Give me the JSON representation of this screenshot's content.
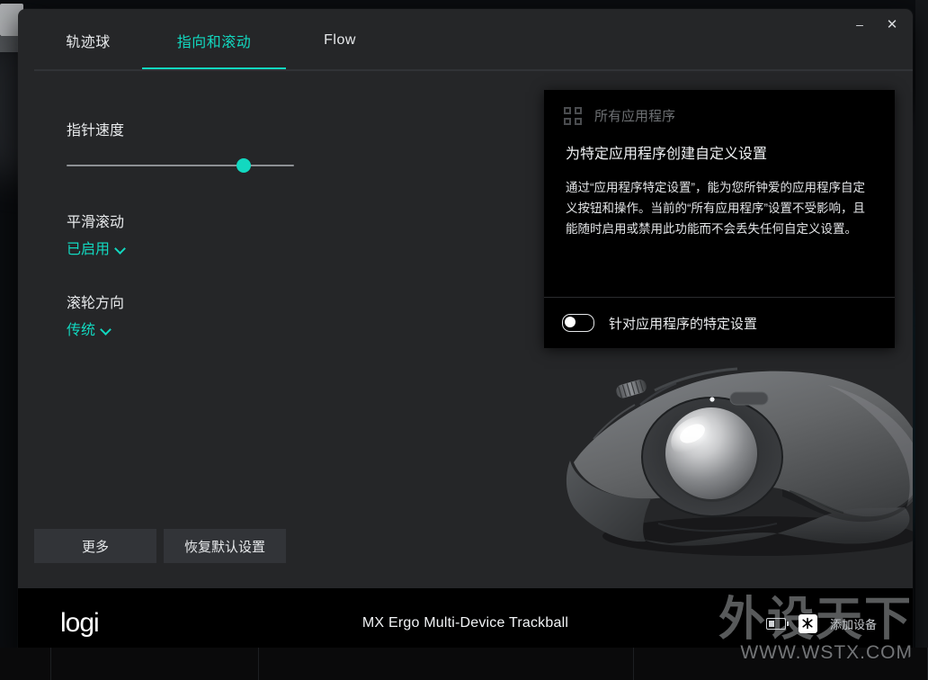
{
  "window": {
    "controls": {
      "minimize": "–",
      "close": "✕"
    }
  },
  "tabs": [
    {
      "label": "轨迹球",
      "active": false
    },
    {
      "label": "指向和滚动",
      "active": true
    },
    {
      "label": "Flow",
      "active": false
    }
  ],
  "settings": {
    "pointer_speed": {
      "label": "指针速度",
      "value_percent": 78
    },
    "smooth_scroll": {
      "label": "平滑滚动",
      "value": "已启用"
    },
    "scroll_direction": {
      "label": "滚轮方向",
      "value": "传统"
    }
  },
  "actions": {
    "more": "更多",
    "restore_defaults": "恢复默认设置"
  },
  "popup": {
    "header_label": "所有应用程序",
    "title": "为特定应用程序创建自定义设置",
    "body": "通过“应用程序特定设置”，能为您所钟爱的应用程序自定义按钮和操作。当前的“所有应用程序”设置不受影响，且能随时启用或禁用此功能而不会丢失任何自定义设置。",
    "toggle_label": "针对应用程序的特定设置",
    "toggle_state": "off"
  },
  "footer": {
    "brand": "logi",
    "device_name": "MX Ergo Multi-Device Trackball",
    "add_device": "添加设备"
  },
  "watermark": {
    "main": "外设天下",
    "sub": "WWW.WSTX.COM"
  },
  "colors": {
    "accent": "#12d8c0",
    "window_bg": "#252628",
    "panel_bg": "#000000",
    "text": "#e9ebed",
    "muted": "#6d7073"
  }
}
